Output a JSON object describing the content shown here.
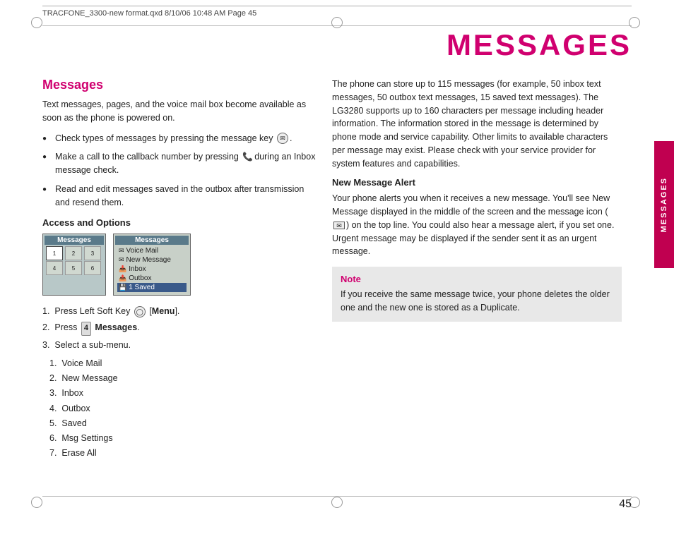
{
  "header": {
    "file_info": "TRACFONE_3300-new format.qxd  8/10/06  10:48 AM  Page 45"
  },
  "page_title": "MESSAGES",
  "left_column": {
    "section_heading": "Messages",
    "intro_text": "Text messages, pages, and the voice mail box become available as soon as the phone is powered on.",
    "bullets": [
      "Check types of messages by pressing the message key.",
      "Make a call to the callback number by pressing during an Inbox message check.",
      "Read and edit messages saved in the outbox after transmission and resend them."
    ],
    "access_heading": "Access and Options",
    "steps": [
      {
        "number": "1.",
        "text": "Press Left Soft Key",
        "suffix": " [Menu]."
      },
      {
        "number": "2.",
        "text": "Press",
        "key": "4",
        "bold_text": "Messages."
      },
      {
        "number": "3.",
        "text": "Select a sub-menu."
      }
    ],
    "submenu_items": [
      {
        "number": "1.",
        "text": "Voice Mail"
      },
      {
        "number": "2.",
        "text": "New Message"
      },
      {
        "number": "3.",
        "text": "Inbox"
      },
      {
        "number": "4.",
        "text": "Outbox"
      },
      {
        "number": "5.",
        "text": "Saved"
      },
      {
        "number": "6.",
        "text": "Msg Settings"
      },
      {
        "number": "7.",
        "text": "Erase All"
      }
    ],
    "phone_screen_top": {
      "title": "Messages",
      "icons": [
        "✉",
        "📋",
        "📁",
        "📦",
        "💾",
        "⚙"
      ]
    },
    "phone_screen_bottom": {
      "title": "Messages",
      "menu_items": [
        {
          "icon": "✉",
          "text": "Voice Mail",
          "highlighted": false
        },
        {
          "icon": "✉",
          "text": "New Message",
          "highlighted": false
        },
        {
          "icon": "📥",
          "text": "Inbox",
          "highlighted": false
        },
        {
          "icon": "📤",
          "text": "Outbox",
          "highlighted": false
        },
        {
          "icon": "💾",
          "text": "1 Saved",
          "highlighted": true
        }
      ]
    }
  },
  "right_column": {
    "intro_text": "The phone can store up to 115 messages (for example, 50 inbox text messages, 50 outbox text messages, 15 saved text messages). The LG3280 supports up to 160 characters per message including header information. The information stored in the message is determined by phone mode and service capability. Other limits to available characters per message may exist. Please check with your service provider for system features and capabilities.",
    "new_message_heading": "New Message Alert",
    "new_message_text": "Your phone alerts you when it receives a new message. You'll see New Message displayed in the middle of the screen and the message icon on the top line. You could also hear a message alert, if you set one. Urgent message may be displayed if the sender sent it as an urgent message.",
    "note": {
      "title": "Note",
      "text": "If you receive the same message twice, your phone deletes the older one and the new one is stored as a Duplicate."
    }
  },
  "side_tab_label": "MESSAGES",
  "page_number": "45"
}
